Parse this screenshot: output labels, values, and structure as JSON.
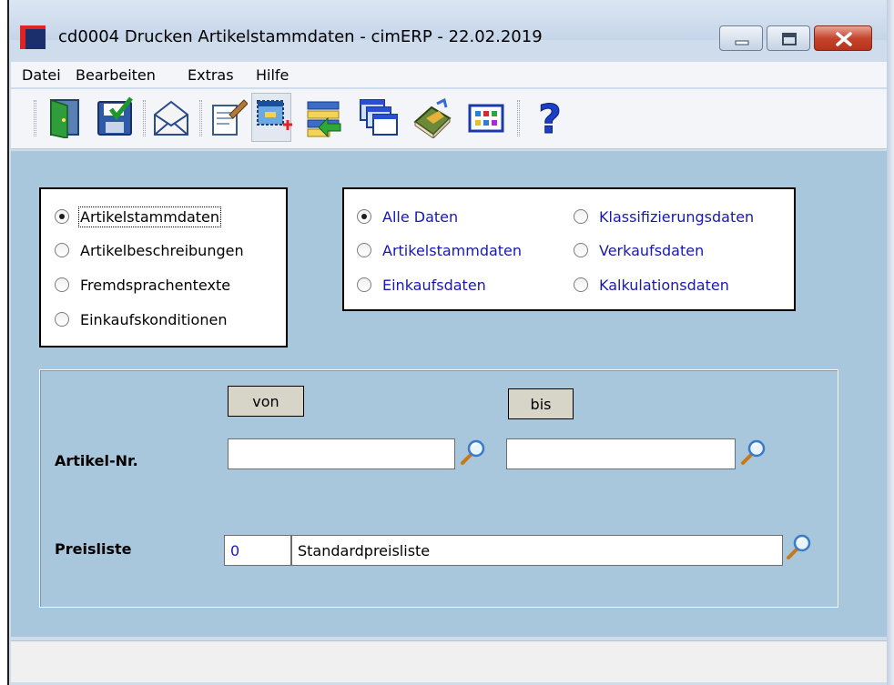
{
  "window": {
    "title": "cd0004 Drucken Artikelstammdaten - cimERP - 22.02.2019"
  },
  "menu": [
    "Datei",
    "Bearbeiten",
    "Extras",
    "Hilfe"
  ],
  "toolbar": {
    "icons": [
      "exit-door-icon",
      "save-icon",
      "email-icon",
      "edit-document-icon",
      "new-selection-icon",
      "transfer-list-icon",
      "cascade-windows-icon",
      "manual-book-icon",
      "table-grid-icon",
      "help-icon"
    ],
    "help_glyph": "?"
  },
  "report_type": {
    "options": [
      "Artikelstammdaten",
      "Artikelbeschreibungen",
      "Fremdsprachentexte",
      "Einkaufskonditionen"
    ],
    "selected": "Artikelstammdaten"
  },
  "data_scope": {
    "options": [
      "Alle Daten",
      "Klassifizierungsdaten",
      "Artikelstammdaten",
      "Verkaufsdaten",
      "Einkaufsdaten",
      "Kalkulationsdaten"
    ],
    "selected": "Alle Daten"
  },
  "filter": {
    "from_header": "von",
    "to_header": "bis",
    "article_label": "Artikel-Nr.",
    "article_from": "",
    "article_to": "",
    "pricelist_label": "Preisliste",
    "pricelist_number": "0",
    "pricelist_name": "Standardpreisliste"
  },
  "colors": {
    "content_bg": "#a8c6dc",
    "option_blue": "#1818b8",
    "close_red": "#c5452e"
  }
}
